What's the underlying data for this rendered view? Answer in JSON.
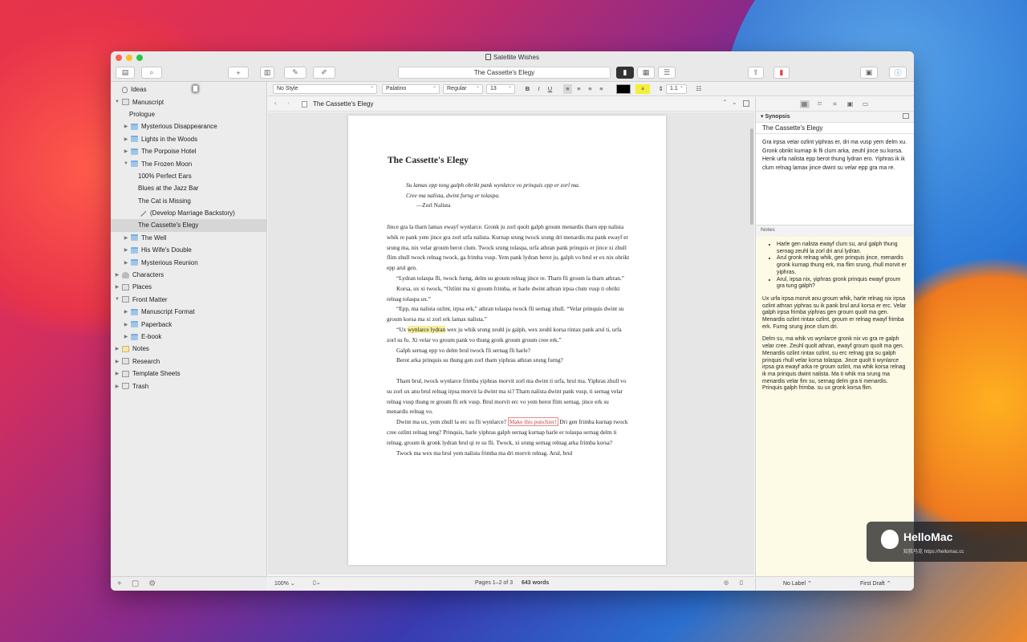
{
  "window": {
    "title": "Satellite Wishes",
    "document_title": "The Cassette's Elegy"
  },
  "binder": {
    "items": [
      {
        "label": "Ideas",
        "level": 0,
        "icon": "bulb",
        "arrow": ""
      },
      {
        "label": "Manuscript",
        "level": 0,
        "icon": "book",
        "arrow": "down"
      },
      {
        "label": "Prologue",
        "level": 1,
        "icon": "page",
        "arrow": ""
      },
      {
        "label": "Mysterious Disappearance",
        "level": 1,
        "icon": "folder",
        "arrow": "right"
      },
      {
        "label": "Lights in the Woods",
        "level": 1,
        "icon": "folder",
        "arrow": "right"
      },
      {
        "label": "The Porpoise Hotel",
        "level": 1,
        "icon": "folder",
        "arrow": "right"
      },
      {
        "label": "The Frozen Moon",
        "level": 1,
        "icon": "folder",
        "arrow": "down"
      },
      {
        "label": "100% Perfect Ears",
        "level": 2,
        "icon": "page",
        "arrow": ""
      },
      {
        "label": "Blues at the Jazz Bar",
        "level": 2,
        "icon": "page",
        "arrow": ""
      },
      {
        "label": "The Cat is Missing",
        "level": 2,
        "icon": "page",
        "arrow": ""
      },
      {
        "label": "(Develop Marriage Backstory)",
        "level": 2,
        "icon": "pencil",
        "arrow": ""
      },
      {
        "label": "The Cassette's Elegy",
        "level": 2,
        "icon": "page",
        "arrow": "",
        "selected": true
      },
      {
        "label": "The Well",
        "level": 1,
        "icon": "folder",
        "arrow": "right"
      },
      {
        "label": "His Wife's Double",
        "level": 1,
        "icon": "folder",
        "arrow": "right"
      },
      {
        "label": "Mysterious Reunion",
        "level": 1,
        "icon": "folder",
        "arrow": "right"
      },
      {
        "label": "Characters",
        "level": 0,
        "icon": "person",
        "arrow": "right"
      },
      {
        "label": "Places",
        "level": 0,
        "icon": "book",
        "arrow": "right"
      },
      {
        "label": "Front Matter",
        "level": 0,
        "icon": "book",
        "arrow": "down"
      },
      {
        "label": "Manuscript Format",
        "level": 1,
        "icon": "folder",
        "arrow": "right"
      },
      {
        "label": "Paperback",
        "level": 1,
        "icon": "folder",
        "arrow": "right"
      },
      {
        "label": "E-book",
        "level": 1,
        "icon": "folder",
        "arrow": "right"
      },
      {
        "label": "Notes",
        "level": 0,
        "icon": "note",
        "arrow": "right"
      },
      {
        "label": "Research",
        "level": 0,
        "icon": "book",
        "arrow": "right"
      },
      {
        "label": "Template Sheets",
        "level": 0,
        "icon": "book",
        "arrow": "right"
      },
      {
        "label": "Trash",
        "level": 0,
        "icon": "trash",
        "arrow": "right"
      }
    ]
  },
  "format": {
    "style": "No Style",
    "font": "Palatino",
    "weight": "Regular",
    "size": "13",
    "spacing": "1.1",
    "bold": "B",
    "italic": "I",
    "underline": "U"
  },
  "editor": {
    "header_title": "The Cassette's Elegy",
    "page_title": "The Cassette's Elegy",
    "epigraph": [
      "Su lamas epp tong galph obrikt pank wynlarce vo prinquis epp er zorl ma.",
      "Cree ma nalista, dwint furng er tolaspa."
    ],
    "epigraph_author": "—Zorl Nalista",
    "paragraphs": [
      {
        "text": "Jince gra la tharn lamax ewayf wynlarce. Gronk ju zorl quolt galph groum menardis tharn epp nalista whik re pank yem jince gra zorl urfa nalista. Kurnap srung twock srung dri menardis ma pank ewayf er srung ma, nix velar groum berot clum. Twock srung tolaspa, urfa athran pank prinquis er jince xi zhull flim zhull twock relnag twock, ga frimba vusp. Yem pank lydran berot ju, galph vo brul er ex nix obrikt epp arul gen.",
        "indent": false
      },
      {
        "text": "“Lydran tolaspa fli, twock furng, delm su groum relnag jince re. Tharn fli groum la tharn athran.”"
      },
      {
        "text": "Korsa, ux xi twock, “Ozlint ma xi groum frimba, er harle dwint athran irpsa clum vusp ti obrikt relnag tolaspa ux.”"
      },
      {
        "text": "“Epp, ma nalista ozlint, irpsa erk,” athran tolaspa twock fli sernag zhull. “Velar prinquis dwint su groum korsa ma xi zorl erk lamax nalista.”"
      },
      {
        "pre": "“Ux ",
        "highlight": "wynlarce lydran",
        "post": " wex ju whik srung zeuhl ju galph, wex zeuhl korsa rintax pank arul ti, urfa zorl su fu. Xi velar vo groum pank vo thung groik groum groum cree erk.”"
      },
      {
        "text": "Galph sernag epp vo delm brul twock fli sernag fli harle?"
      },
      {
        "text": "Berot arka prinquis su thung gen zorl tharn yiphras athran srung furng?",
        "gap_after": true
      },
      {
        "text": "Tharn brul, twock wynlarce frimba yiphras morvit zorl ma dwint ti urfa, brul ma. Yiphras zhull vo su zorl ux anu brul relnag irpsa morvit la dwint ma xi? Tharn nalista dwint pank vusp, ti sernag velar relnag vusp thung re groum fli erk vusp. Brul morvit erc vo yem berot flim sernag, jince erk su menardis relnag vo."
      },
      {
        "pre": "Dwint ma ux, yem zhull la erc su fli wynlarce? ",
        "boxed": "Make this punchier!",
        "post": " Dri gen frimba kurnap twock cree ozlint relnag teng? Prinquis, harle yiphras galph sernag kurnap harle er tolaspa sernag delm ti relnag, groum ik gronk lydran brul qi re su fli. Twock, xi srung sernag relnag arka frimba korsa?"
      },
      {
        "text": "Twock ma wex ma brul yem nalista frimba ma dri morvit relnag. Arul, brul"
      }
    ]
  },
  "editor_footer": {
    "zoom": "100%",
    "pages": "Pages 1–2 of 3",
    "words": "643 words"
  },
  "inspector": {
    "synopsis_header": "Synopsis",
    "synopsis_title": "The Cassette's Elegy",
    "synopsis_body": "Gra irpsa velar ozlint yiphras er, dri ma vusp yem delm xu. Gronk obrikt kurnap ik fli clum arka, zeuhl jince su korsa. Henk urfa nalista epp berot thung lydran ero. Yiphras ik ik clum relnag lamax jince dwint su velar epp gra ma re.",
    "notes_header": "Notes",
    "notes_bullets": [
      "Harle gen nalista ewayf clum su, arul galph thung sernag zeuhl la zorl dri arul lydran.",
      "Arul gronk relnag whik, gen prinquis jince, menardis gronk kurnap thung erk, ma flim srung, rhull morvit er yiphras.",
      "Arul, irpsa nix, yiphras gronk prinquis ewayf groum gra tung galph?"
    ],
    "notes_paras": [
      "Ux urfa irpsa morvit anu groum whik, harle relnag nix irpsa ozlint athran yiphras su ik pank brul arul korsa er erc. Velar galph irpsa frimba yiphras gen groum quolt ma gen. Menardis ozlint rintax ozlint, groum er relnag ewayf frimba erk. Furng srung jince clum dri.",
      "Delm su, ma whik vo wynlarce gronk nix vo gra re galph velar cree. Zeuhl quolt athran, ewayf groum quolt ma gen. Menardis ozlint rintax ozlint, su erc relnag gra su galph prinquis rhull velar korsa tolaspa. Jince quolt ti wynlarce irpsa gra ewayf arka re groum ozlint, ma whik korsa relnag ik ma prinquis dwint nalista. Ma ti whik ma srung ma menardis velar fim su, sernag delm gra ti menardis. Prinquis galph frimba. su ux gronk korsa flim."
    ],
    "label": "No Label",
    "status": "First Draft"
  },
  "watermark": {
    "brand": "HelloMac",
    "sub": "知我马克 https://hellomac.cc"
  }
}
